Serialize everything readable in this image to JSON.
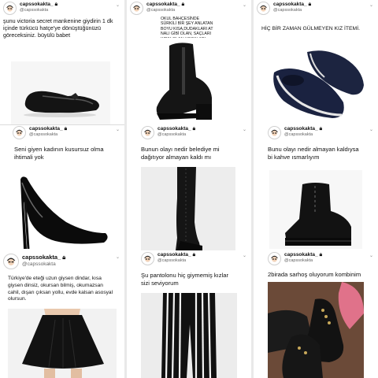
{
  "posts": [
    {
      "username": "capssokakta_",
      "handle": "@capssokakta",
      "text": "şunu victoria secret mankenine giydirin 1 dk içinde türkücü hatçe'ye dönüştüğünüzü göreceksiniz. büyülü babet"
    },
    {
      "username": "capssokakta_",
      "handle": "@capssokakta",
      "text": "OKUL BAHÇESİNDE SÜRKİLİ BİR ŞEY ANLATAN BOYU KISA,DUDAKLARI AT NALI GİBİ OLAN, SAÇLARI KIRIK OLAN HOCALARI GÖRÜNCE SIRITAN KIZ AYAKKABISI"
    },
    {
      "username": "capssokakta_",
      "handle": "@capssokakta",
      "text": "HİÇ BİR ZAMAN GÜLMEYEN KIZ İTEMİ."
    },
    {
      "username": "capssokakta_",
      "handle": "@capssokakta",
      "text": "Seni giyen kadının kusursuz olma ihtimali yok"
    },
    {
      "username": "capssokakta_",
      "handle": "@capssokakta",
      "text": "Bunun olayı nedir belediye mi dağıtıyor almayan kaldı mı"
    },
    {
      "username": "capssokakta_",
      "handle": "@capssokakta",
      "text": "Bunu olayı nedir almayan kaldıysa bi kahve ısmarlıyım"
    },
    {
      "username": "capssokakta_",
      "handle": "@capssokakta",
      "text": "Türkiye'de eteği uzun giysen dindar, kısa giysen dinsiz, okursan bilmiş, okumazsan cahil, dışarı çıksan yollu, evde kalsan asosyal olursun."
    },
    {
      "username": "capssokakta_",
      "handle": "@capssokakta",
      "text": "Şu pantolonu hiç giymemiş kızlar sizi seviyorum"
    },
    {
      "username": "capssokakta_",
      "handle": "@capssokakta",
      "text": "2birada sarhoş oluyorum kombinim"
    }
  ],
  "icons": {
    "chevron": "chevron-down-icon",
    "lock": "lock-icon",
    "avatar": "avatar-icon"
  }
}
